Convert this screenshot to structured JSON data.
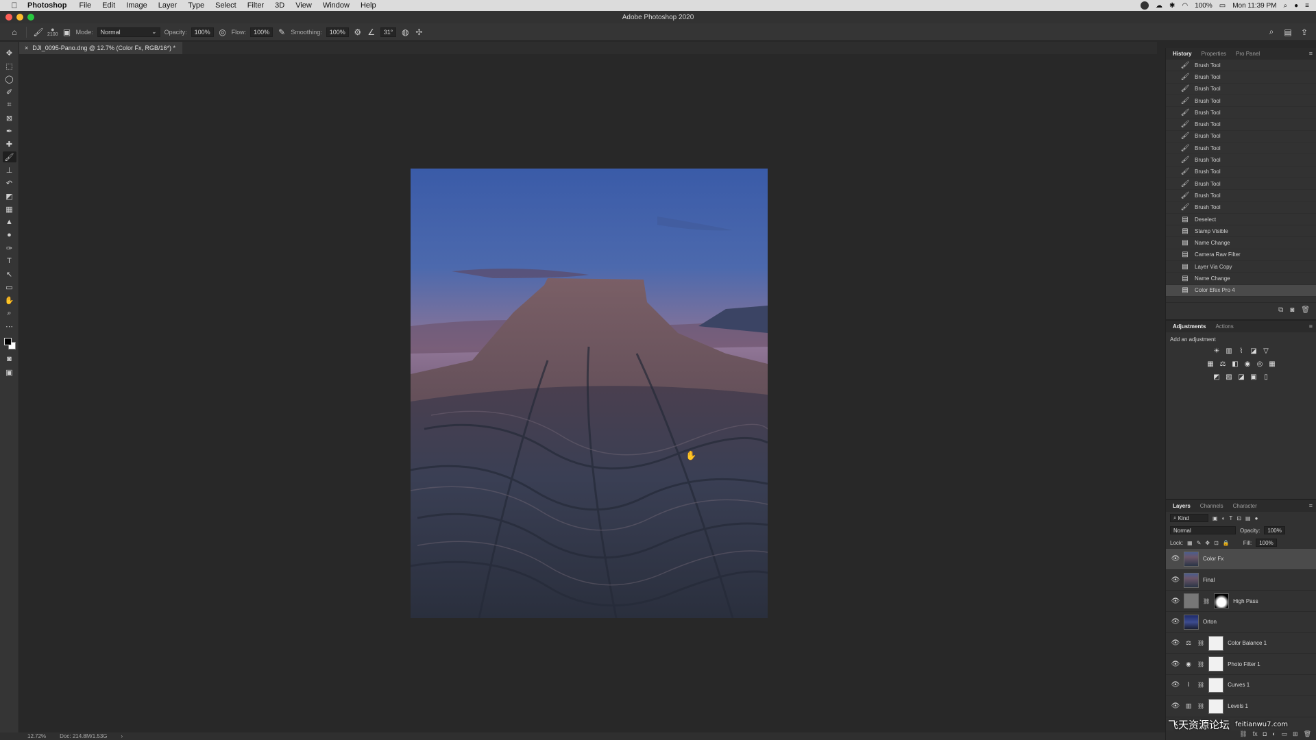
{
  "menubar": {
    "app_name": "Photoshop",
    "items": [
      "File",
      "Edit",
      "Image",
      "Layer",
      "Type",
      "Select",
      "Filter",
      "3D",
      "View",
      "Window",
      "Help"
    ],
    "battery": "100%",
    "clock": "Mon 11:39 PM"
  },
  "titlebar": {
    "title": "Adobe Photoshop 2020"
  },
  "options": {
    "brush_size": "2100",
    "mode_label": "Mode:",
    "mode_value": "Normal",
    "opacity_label": "Opacity:",
    "opacity_value": "100%",
    "flow_label": "Flow:",
    "flow_value": "100%",
    "smoothing_label": "Smoothing:",
    "smoothing_value": "100%",
    "angle_value": "31°"
  },
  "document": {
    "tab_title": "DJI_0095-Pano.dng @ 12.7% (Color Fx, RGB/16*) *"
  },
  "status": {
    "zoom": "12.72%",
    "doc_info": "Doc: 214.8M/1.53G"
  },
  "history": {
    "tabs": [
      "History",
      "Properties",
      "Pro Panel"
    ],
    "items": [
      {
        "label": "Brush Tool",
        "icon": "brush-icon"
      },
      {
        "label": "Brush Tool",
        "icon": "brush-icon"
      },
      {
        "label": "Brush Tool",
        "icon": "brush-icon"
      },
      {
        "label": "Brush Tool",
        "icon": "brush-icon"
      },
      {
        "label": "Brush Tool",
        "icon": "brush-icon"
      },
      {
        "label": "Brush Tool",
        "icon": "brush-icon"
      },
      {
        "label": "Brush Tool",
        "icon": "brush-icon"
      },
      {
        "label": "Brush Tool",
        "icon": "brush-icon"
      },
      {
        "label": "Brush Tool",
        "icon": "brush-icon"
      },
      {
        "label": "Brush Tool",
        "icon": "brush-icon"
      },
      {
        "label": "Brush Tool",
        "icon": "brush-icon"
      },
      {
        "label": "Brush Tool",
        "icon": "brush-icon"
      },
      {
        "label": "Brush Tool",
        "icon": "brush-icon"
      },
      {
        "label": "Deselect",
        "icon": "document-icon"
      },
      {
        "label": "Stamp Visible",
        "icon": "document-icon"
      },
      {
        "label": "Name Change",
        "icon": "document-icon"
      },
      {
        "label": "Camera Raw Filter",
        "icon": "document-icon"
      },
      {
        "label": "Layer Via Copy",
        "icon": "document-icon"
      },
      {
        "label": "Name Change",
        "icon": "document-icon"
      },
      {
        "label": "Color Efex Pro 4",
        "icon": "document-icon"
      }
    ]
  },
  "adjustments": {
    "tabs": [
      "Adjustments",
      "Actions"
    ],
    "caption": "Add an adjustment"
  },
  "layers": {
    "tabs": [
      "Layers",
      "Channels",
      "Character"
    ],
    "filter_kind": "Kind",
    "blend_mode": "Normal",
    "opacity_label": "Opacity:",
    "opacity_value": "100%",
    "lock_label": "Lock:",
    "fill_label": "Fill:",
    "fill_value": "100%",
    "items": [
      {
        "name": "Color Fx"
      },
      {
        "name": "Final"
      },
      {
        "name": "High Pass"
      },
      {
        "name": "Orton"
      },
      {
        "name": "Color Balance 1"
      },
      {
        "name": "Photo Filter 1"
      },
      {
        "name": "Curves 1"
      },
      {
        "name": "Levels 1"
      }
    ]
  },
  "watermark": {
    "text": "飞天资源论坛",
    "url": "feitianwu7.com"
  }
}
